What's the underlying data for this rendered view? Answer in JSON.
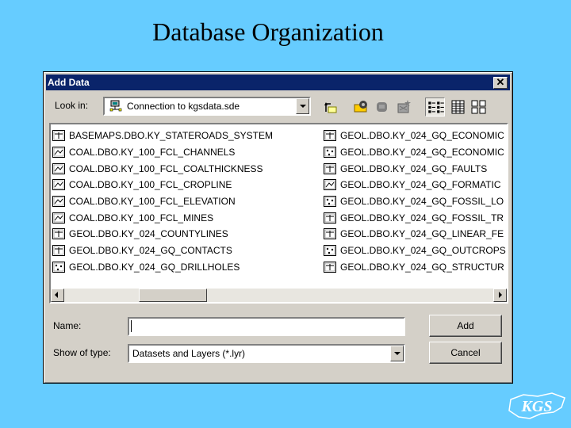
{
  "slide": {
    "title": "Database Organization"
  },
  "dialog": {
    "title": "Add Data",
    "close_glyph": "✕",
    "look_in_label": "Look in:",
    "look_in_value": "Connection to kgsdata.sde",
    "name_label": "Name:",
    "name_value": "",
    "type_label": "Show of type:",
    "type_value": "Datasets and Layers (*.lyr)",
    "add_label": "Add",
    "cancel_label": "Cancel"
  },
  "toolbar": {
    "buttons": [
      {
        "icon": "up-one-level-icon"
      },
      {
        "icon": "connect-to-folder-icon"
      },
      {
        "icon": "disconnect-icon"
      },
      {
        "icon": "new-folder-icon"
      },
      {
        "icon": "list-view-icon"
      },
      {
        "icon": "details-view-icon"
      },
      {
        "icon": "thumbnails-view-icon"
      }
    ]
  },
  "files": {
    "column1": [
      {
        "icon": "road-feature-icon",
        "label": "BASEMAPS.DBO.KY_STATEROADS_SYSTEM"
      },
      {
        "icon": "line-feature-icon",
        "label": "COAL.DBO.KY_100_FCL_CHANNELS"
      },
      {
        "icon": "line-feature-icon",
        "label": "COAL.DBO.KY_100_FCL_COALTHICKNESS"
      },
      {
        "icon": "line-feature-icon",
        "label": "COAL.DBO.KY_100_FCL_CROPLINE"
      },
      {
        "icon": "line-feature-icon",
        "label": "COAL.DBO.KY_100_FCL_ELEVATION"
      },
      {
        "icon": "line-feature-icon",
        "label": "COAL.DBO.KY_100_FCL_MINES"
      },
      {
        "icon": "road-feature-icon",
        "label": "GEOL.DBO.KY_024_COUNTYLINES"
      },
      {
        "icon": "road-feature-icon",
        "label": "GEOL.DBO.KY_024_GQ_CONTACTS"
      },
      {
        "icon": "point-feature-icon",
        "label": "GEOL.DBO.KY_024_GQ_DRILLHOLES"
      }
    ],
    "column2": [
      {
        "icon": "road-feature-icon",
        "label": "GEOL.DBO.KY_024_GQ_ECONOMIC"
      },
      {
        "icon": "point-feature-icon",
        "label": "GEOL.DBO.KY_024_GQ_ECONOMIC"
      },
      {
        "icon": "road-feature-icon",
        "label": "GEOL.DBO.KY_024_GQ_FAULTS"
      },
      {
        "icon": "line-feature-icon",
        "label": "GEOL.DBO.KY_024_GQ_FORMATIC"
      },
      {
        "icon": "point-feature-icon",
        "label": "GEOL.DBO.KY_024_GQ_FOSSIL_LO"
      },
      {
        "icon": "road-feature-icon",
        "label": "GEOL.DBO.KY_024_GQ_FOSSIL_TR"
      },
      {
        "icon": "road-feature-icon",
        "label": "GEOL.DBO.KY_024_GQ_LINEAR_FE"
      },
      {
        "icon": "point-feature-icon",
        "label": "GEOL.DBO.KY_024_GQ_OUTCROPS"
      },
      {
        "icon": "road-feature-icon",
        "label": "GEOL.DBO.KY_024_GQ_STRUCTUR"
      }
    ]
  },
  "logo": {
    "text": "KGS",
    "icon": "kgs-logo-icon"
  },
  "colors": {
    "background": "#66ccff",
    "titlebar": "#0a246a",
    "dialog_face": "#d4d0c8"
  }
}
